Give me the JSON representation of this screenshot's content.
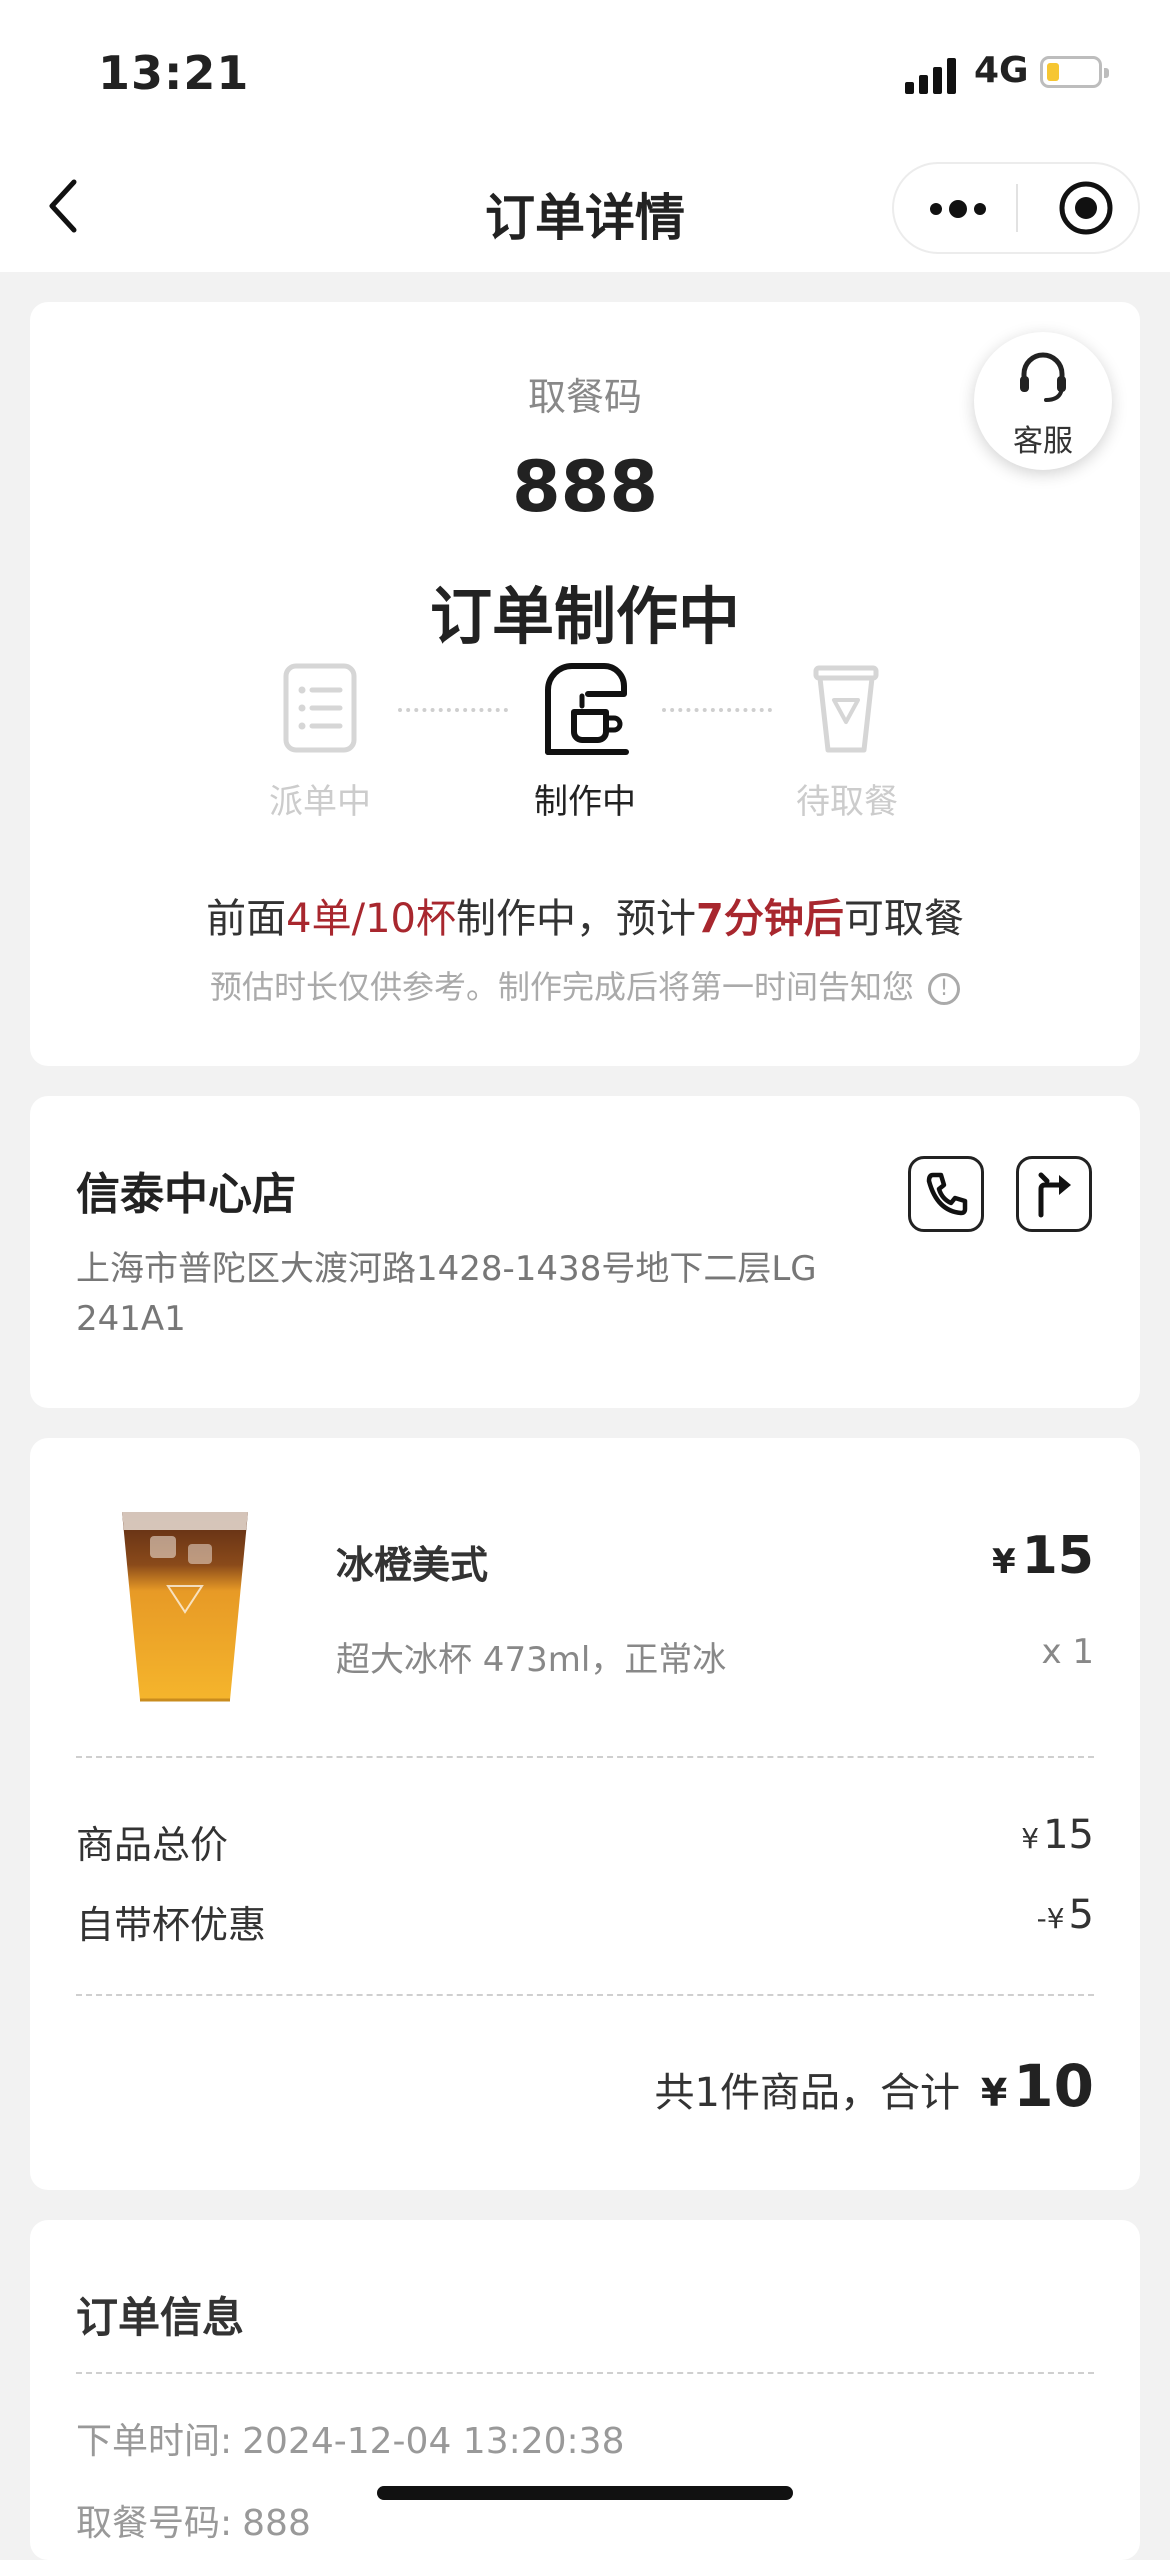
{
  "status_bar": {
    "time": "13:21",
    "network": "4G",
    "battery_level": 0.25
  },
  "nav": {
    "title": "订单详情",
    "more_icon": "more-dots-icon",
    "close_icon": "target-icon"
  },
  "service": {
    "label": "客服",
    "icon": "headset-icon"
  },
  "pickup": {
    "label": "取餐码",
    "code": "888",
    "status": "订单制作中",
    "steps": [
      {
        "label": "派单中",
        "icon": "list-icon",
        "active": false
      },
      {
        "label": "制作中",
        "icon": "coffee-machine-icon",
        "active": true
      },
      {
        "label": "待取餐",
        "icon": "cup-icon",
        "active": false
      }
    ],
    "queue_prefix": "前面",
    "queue_count": "4单/10杯",
    "queue_mid": "制作中，预计",
    "queue_time": "7分钟后",
    "queue_suffix": "可取餐",
    "hint": "预估时长仅供参考。制作完成后将第一时间告知您",
    "accent_color": "#a8272e"
  },
  "store": {
    "name": "信泰中心店",
    "address": "上海市普陀区大渡河路1428-1438号地下二层LG 241A1",
    "call_icon": "phone-icon",
    "nav_icon": "directions-icon"
  },
  "order": {
    "item": {
      "name": "冰橙美式",
      "currency": "¥",
      "price": "15",
      "spec": "超大冰杯 473ml，正常冰",
      "qty": "x 1"
    },
    "subtotal_label": "商品总价",
    "subtotal_currency": "¥",
    "subtotal_value": "15",
    "discount_label": "自带杯优惠",
    "discount_currency": "-¥",
    "discount_value": "5",
    "total_label": "共1件商品，合计",
    "total_currency": "¥",
    "total_value": "10"
  },
  "order_info": {
    "title": "订单信息",
    "time_label": "下单时间:",
    "time_value": "2024-12-04 13:20:38",
    "code_label": "取餐号码:",
    "code_value": "888"
  }
}
